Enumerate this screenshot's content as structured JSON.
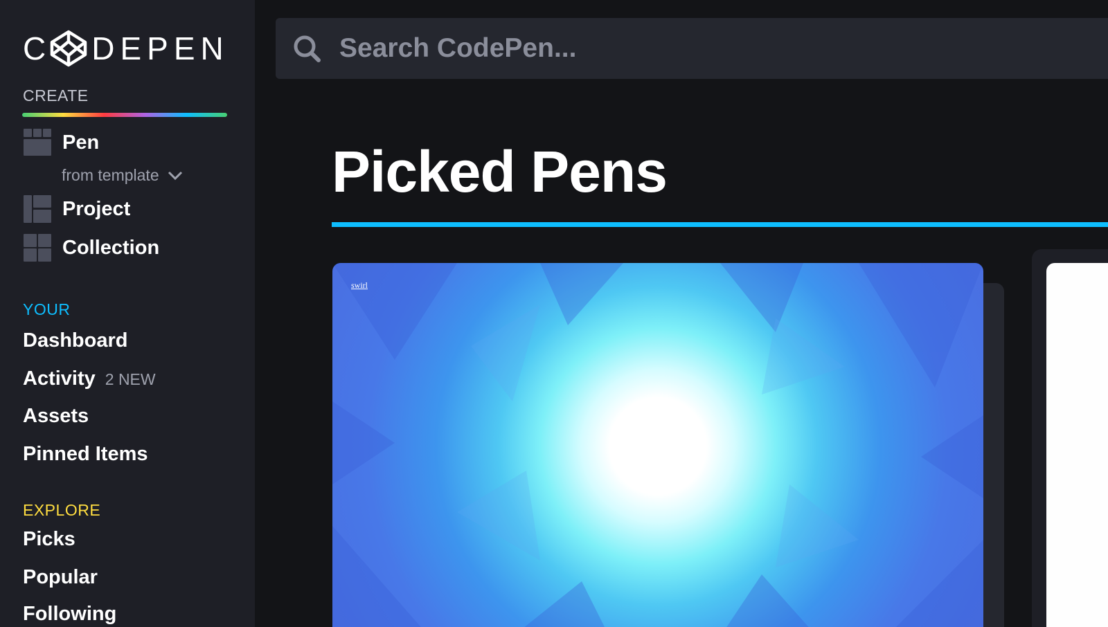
{
  "brand": {
    "name": "C DEPEN"
  },
  "sidebar": {
    "create_label": "CREATE",
    "create_items": [
      {
        "label": "Pen",
        "icon": "pen-grid-icon"
      },
      {
        "label": "Project",
        "icon": "project-layout-icon"
      },
      {
        "label": "Collection",
        "icon": "collection-grid-icon"
      }
    ],
    "from_template": "from template",
    "your_label": "YOUR",
    "your_items": [
      {
        "label": "Dashboard"
      },
      {
        "label": "Activity",
        "badge": "2 NEW"
      },
      {
        "label": "Assets"
      },
      {
        "label": "Pinned Items"
      }
    ],
    "explore_label": "EXPLORE",
    "explore_items": [
      {
        "label": "Picks"
      },
      {
        "label": "Popular"
      },
      {
        "label": "Following"
      }
    ]
  },
  "search": {
    "placeholder": "Search CodePen..."
  },
  "main": {
    "title": "Picked Pens",
    "cards": [
      {
        "link_text": "swirl"
      }
    ]
  },
  "colors": {
    "sidebar_bg": "#1e1f26",
    "page_bg": "#131417",
    "accent_blue": "#0ebeff",
    "accent_yellow": "#ffdd40",
    "search_bg": "#25272f"
  }
}
